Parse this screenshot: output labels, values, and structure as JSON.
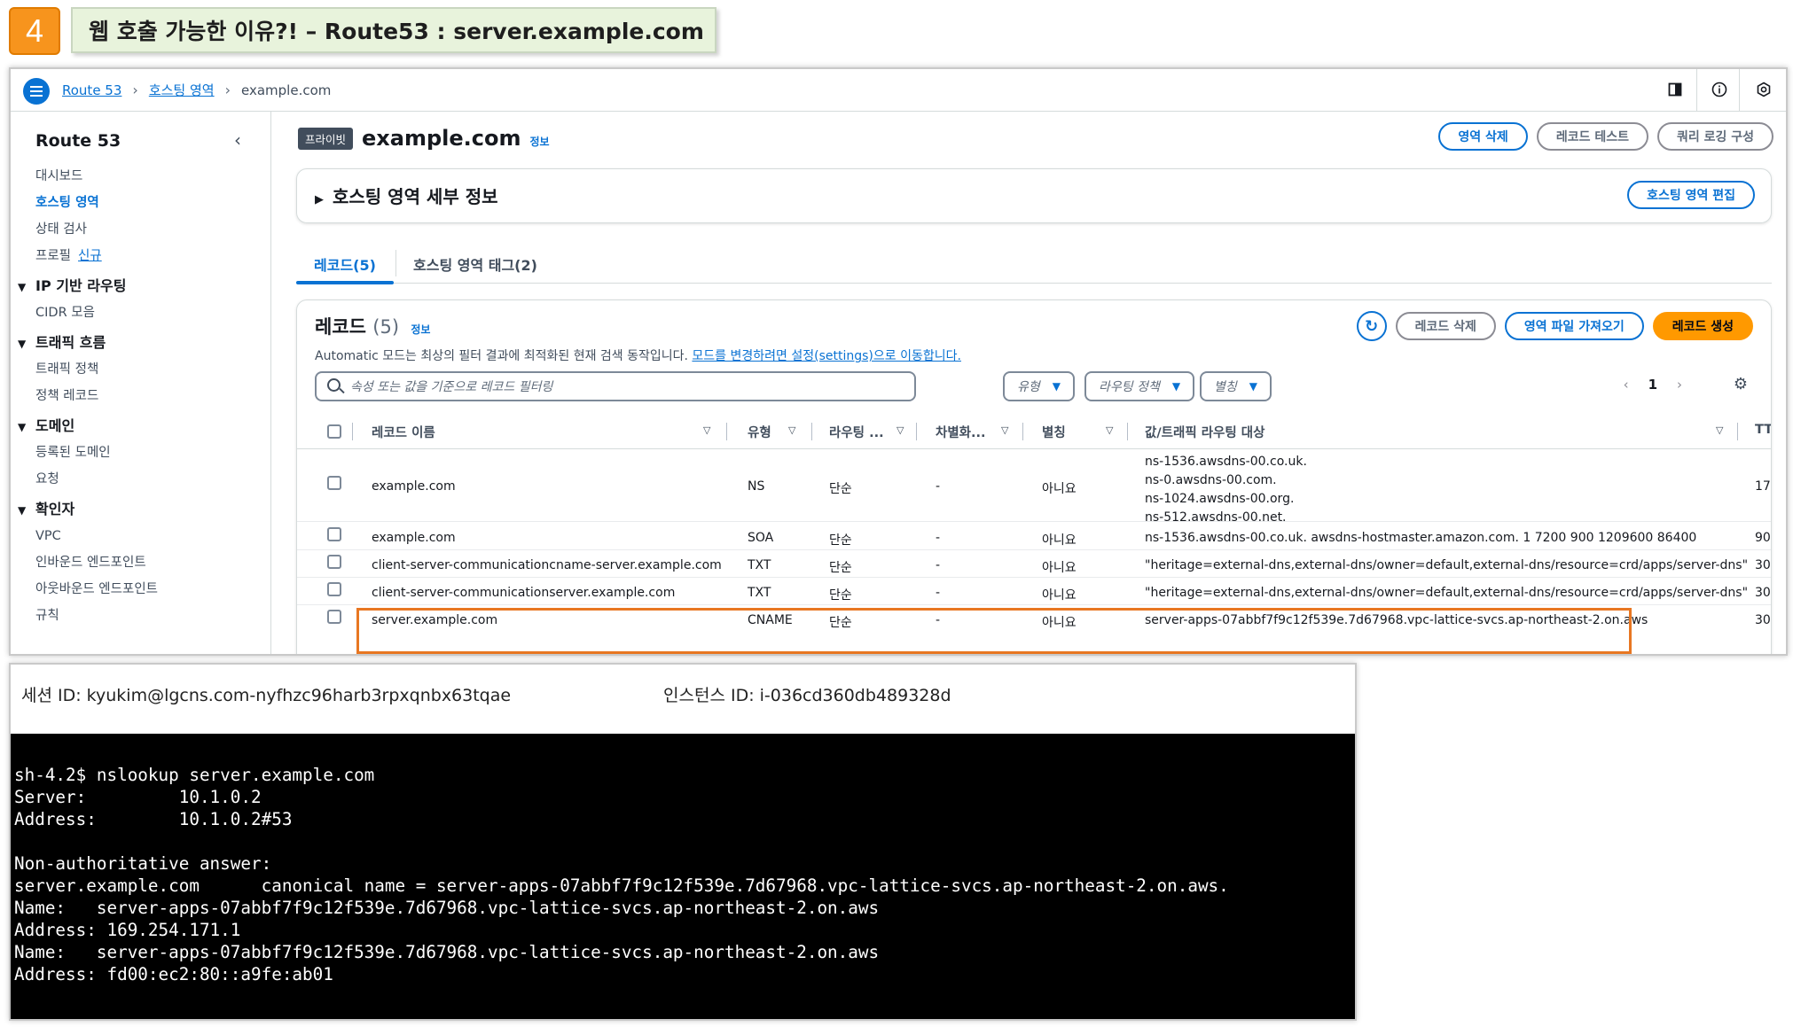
{
  "slide": {
    "step_number": "4",
    "title": "웹 호출 가능한 이유?! – Route53 : server.example.com"
  },
  "console": {
    "breadcrumbs": [
      "Route 53",
      "호스팅 영역",
      "example.com"
    ],
    "sidebar": {
      "title": "Route 53",
      "items_top": [
        {
          "label": "대시보드"
        },
        {
          "label": "호스팅 영역",
          "active": true
        },
        {
          "label": "상태 검사"
        },
        {
          "label": "프로필",
          "badge": "신규"
        }
      ],
      "sections": [
        {
          "label": "IP 기반 라우팅",
          "items": [
            "CIDR 모음"
          ]
        },
        {
          "label": "트래픽 흐름",
          "items": [
            "트래픽 정책",
            "정책 레코드"
          ]
        },
        {
          "label": "도메인",
          "items": [
            "등록된 도메인",
            "요청"
          ]
        },
        {
          "label": "확인자",
          "items": [
            "VPC",
            "인바운드 엔드포인트",
            "아웃바운드 엔드포인트",
            "규칙"
          ]
        }
      ]
    },
    "header": {
      "badge": "프라이빗",
      "title": "example.com",
      "info": "정보",
      "buttons": {
        "delete_zone": "영역 삭제",
        "test_record": "레코드 테스트",
        "query_logging": "쿼리 로깅 구성"
      }
    },
    "details": {
      "label": "호스팅 영역 세부 정보",
      "edit_button": "호스팅 영역 편집"
    },
    "tabs": {
      "records": "레코드(5)",
      "tags": "호스팅 영역 태그(2)"
    },
    "records": {
      "title": "레코드",
      "count": "(5)",
      "info": "정보",
      "desc": "Automatic 모드는 최상의 필터 결과에 최적화된 현재 검색 동작입니다.",
      "desc_link": "모드를 변경하려면 설정(settings)으로 이동합니다.",
      "buttons": {
        "delete": "레코드 삭제",
        "import": "영역 파일 가져오기",
        "create": "레코드 생성"
      },
      "filter_placeholder": "속성 또는 값을 기준으로 레코드 필터링",
      "dropdowns": {
        "type": "유형",
        "policy": "라우팅 정책",
        "alias": "별칭"
      },
      "page": "1",
      "columns": {
        "name": "레코드 이름",
        "type": "유형",
        "routing": "라우팅 ...",
        "diff": "차별화...",
        "alias": "별칭",
        "value": "값/트래픽 라우팅 대상",
        "ttl": "TT"
      },
      "rows": [
        {
          "name": "example.com",
          "type": "NS",
          "routing": "단순",
          "diff": "-",
          "alias": "아니요",
          "value": [
            "ns-1536.awsdns-00.co.uk.",
            "ns-0.awsdns-00.com.",
            "ns-1024.awsdns-00.org.",
            "ns-512.awsdns-00.net."
          ],
          "ttl": "17"
        },
        {
          "name": "example.com",
          "type": "SOA",
          "routing": "단순",
          "diff": "-",
          "alias": "아니요",
          "value": [
            "ns-1536.awsdns-00.co.uk. awsdns-hostmaster.amazon.com. 1 7200 900 1209600 86400"
          ],
          "ttl": "90"
        },
        {
          "name": "client-server-communicationcname-server.example.com",
          "type": "TXT",
          "routing": "단순",
          "diff": "-",
          "alias": "아니요",
          "value": [
            "\"heritage=external-dns,external-dns/owner=default,external-dns/resource=crd/apps/server-dns\""
          ],
          "ttl": "30"
        },
        {
          "name": "client-server-communicationserver.example.com",
          "type": "TXT",
          "routing": "단순",
          "diff": "-",
          "alias": "아니요",
          "value": [
            "\"heritage=external-dns,external-dns/owner=default,external-dns/resource=crd/apps/server-dns\""
          ],
          "ttl": "30"
        },
        {
          "name": "server.example.com",
          "type": "CNAME",
          "routing": "단순",
          "diff": "-",
          "alias": "아니요",
          "value": [
            "server-apps-07abbf7f9c12f539e.7d67968.vpc-lattice-svcs.ap-northeast-2.on.aws"
          ],
          "ttl": "30"
        }
      ]
    }
  },
  "session": {
    "session_id": "세션 ID: kyukim@lgcns.com-nyfhzc96harb3rpxqnbx63tqae",
    "instance_id": "인스턴스 ID: i-036cd360db489328d"
  },
  "terminal": {
    "lines": [
      "sh-4.2$ nslookup server.example.com",
      "Server:         10.1.0.2",
      "Address:        10.1.0.2#53",
      "",
      "Non-authoritative answer:",
      "server.example.com      canonical name = server-apps-07abbf7f9c12f539e.7d67968.vpc-lattice-svcs.ap-northeast-2.on.aws.",
      "Name:   server-apps-07abbf7f9c12f539e.7d67968.vpc-lattice-svcs.ap-northeast-2.on.aws",
      "Address: 169.254.171.1",
      "Name:   server-apps-07abbf7f9c12f539e.7d67968.vpc-lattice-svcs.ap-northeast-2.on.aws",
      "Address: fd00:ec2:80::a9fe:ab01"
    ]
  },
  "colors": {
    "accent": "#0972d3",
    "orange": "#ff9900",
    "highlight": "#e87722",
    "badge": "#f7941d"
  }
}
